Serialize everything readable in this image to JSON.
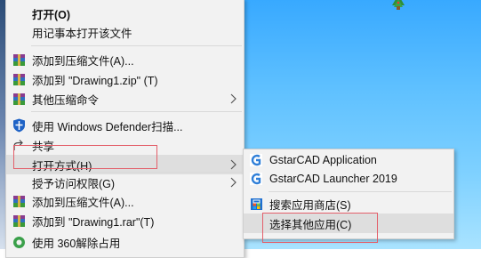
{
  "context_menu": {
    "items": [
      {
        "label": "打开(O)"
      },
      {
        "label": "用记事本打开该文件"
      },
      {
        "label": "添加到压缩文件(A)..."
      },
      {
        "label": "添加到 \"Drawing1.zip\" (T)"
      },
      {
        "label": "其他压缩命令"
      },
      {
        "label": "使用 Windows Defender扫描..."
      },
      {
        "label": "共享"
      },
      {
        "label": "打开方式(H)"
      },
      {
        "label": "授予访问权限(G)"
      },
      {
        "label": "添加到压缩文件(A)..."
      },
      {
        "label": "添加到 \"Drawing1.rar\"(T)"
      },
      {
        "label": "使用 360解除占用"
      }
    ]
  },
  "open_with_submenu": {
    "items": [
      {
        "label": "GstarCAD Application"
      },
      {
        "label": "GstarCAD Launcher 2019"
      },
      {
        "label": "搜索应用商店(S)"
      },
      {
        "label": "选择其他应用(C)"
      }
    ]
  },
  "colors": {
    "highlight_box": "#e35f6a",
    "menu_background": "#f2f2f2",
    "desktop_sky": "#5ec0ff"
  }
}
